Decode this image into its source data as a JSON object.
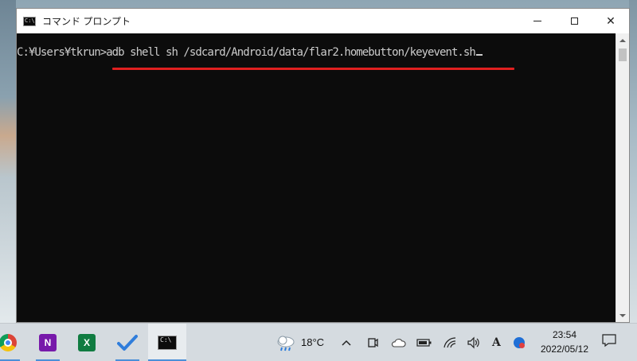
{
  "window": {
    "title": "コマンド プロンプト",
    "icon_glyph": "C:\\",
    "controls": {
      "minimize": "minimize-icon",
      "maximize": "maximize-icon",
      "close": "✕"
    }
  },
  "console": {
    "prompt": "C:¥Users¥tkrun>",
    "command": "adb shell sh /sdcard/Android/data/flar2.homebutton/keyevent.sh",
    "highlight_color": "#e02020"
  },
  "taskbar": {
    "apps": [
      {
        "name": "chrome-icon"
      },
      {
        "name": "onenote-icon",
        "glyph": "N"
      },
      {
        "name": "excel-icon",
        "glyph": "X"
      },
      {
        "name": "todo-icon"
      },
      {
        "name": "cmd-icon",
        "glyph": "C:\\"
      }
    ],
    "weather": {
      "icon": "weather-cloud-rain-icon",
      "temperature": "18°C"
    },
    "tray_icons": [
      "chevron-up-icon",
      "meet-now-icon",
      "onedrive-cloud-icon",
      "battery-icon",
      "wifi-icon",
      "volume-icon",
      "ime-icon",
      "bluetooth-icon"
    ],
    "ime_glyph": "A",
    "clock": {
      "time": "23:54",
      "date": "2022/05/12"
    }
  }
}
